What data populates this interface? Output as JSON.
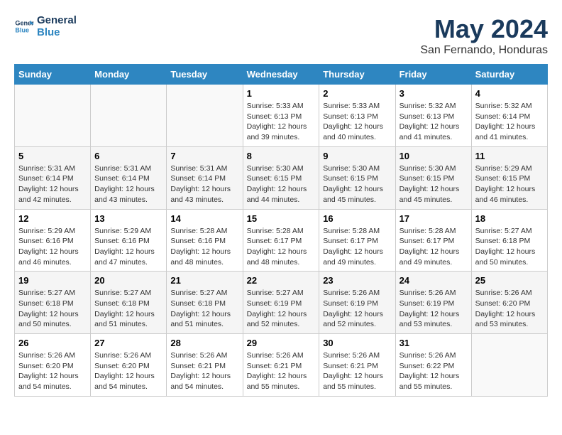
{
  "logo": {
    "line1": "General",
    "line2": "Blue"
  },
  "title": "May 2024",
  "subtitle": "San Fernando, Honduras",
  "weekdays": [
    "Sunday",
    "Monday",
    "Tuesday",
    "Wednesday",
    "Thursday",
    "Friday",
    "Saturday"
  ],
  "weeks": [
    [
      {
        "day": "",
        "info": ""
      },
      {
        "day": "",
        "info": ""
      },
      {
        "day": "",
        "info": ""
      },
      {
        "day": "1",
        "info": "Sunrise: 5:33 AM\nSunset: 6:13 PM\nDaylight: 12 hours\nand 39 minutes."
      },
      {
        "day": "2",
        "info": "Sunrise: 5:33 AM\nSunset: 6:13 PM\nDaylight: 12 hours\nand 40 minutes."
      },
      {
        "day": "3",
        "info": "Sunrise: 5:32 AM\nSunset: 6:13 PM\nDaylight: 12 hours\nand 41 minutes."
      },
      {
        "day": "4",
        "info": "Sunrise: 5:32 AM\nSunset: 6:14 PM\nDaylight: 12 hours\nand 41 minutes."
      }
    ],
    [
      {
        "day": "5",
        "info": "Sunrise: 5:31 AM\nSunset: 6:14 PM\nDaylight: 12 hours\nand 42 minutes."
      },
      {
        "day": "6",
        "info": "Sunrise: 5:31 AM\nSunset: 6:14 PM\nDaylight: 12 hours\nand 43 minutes."
      },
      {
        "day": "7",
        "info": "Sunrise: 5:31 AM\nSunset: 6:14 PM\nDaylight: 12 hours\nand 43 minutes."
      },
      {
        "day": "8",
        "info": "Sunrise: 5:30 AM\nSunset: 6:15 PM\nDaylight: 12 hours\nand 44 minutes."
      },
      {
        "day": "9",
        "info": "Sunrise: 5:30 AM\nSunset: 6:15 PM\nDaylight: 12 hours\nand 45 minutes."
      },
      {
        "day": "10",
        "info": "Sunrise: 5:30 AM\nSunset: 6:15 PM\nDaylight: 12 hours\nand 45 minutes."
      },
      {
        "day": "11",
        "info": "Sunrise: 5:29 AM\nSunset: 6:15 PM\nDaylight: 12 hours\nand 46 minutes."
      }
    ],
    [
      {
        "day": "12",
        "info": "Sunrise: 5:29 AM\nSunset: 6:16 PM\nDaylight: 12 hours\nand 46 minutes."
      },
      {
        "day": "13",
        "info": "Sunrise: 5:29 AM\nSunset: 6:16 PM\nDaylight: 12 hours\nand 47 minutes."
      },
      {
        "day": "14",
        "info": "Sunrise: 5:28 AM\nSunset: 6:16 PM\nDaylight: 12 hours\nand 48 minutes."
      },
      {
        "day": "15",
        "info": "Sunrise: 5:28 AM\nSunset: 6:17 PM\nDaylight: 12 hours\nand 48 minutes."
      },
      {
        "day": "16",
        "info": "Sunrise: 5:28 AM\nSunset: 6:17 PM\nDaylight: 12 hours\nand 49 minutes."
      },
      {
        "day": "17",
        "info": "Sunrise: 5:28 AM\nSunset: 6:17 PM\nDaylight: 12 hours\nand 49 minutes."
      },
      {
        "day": "18",
        "info": "Sunrise: 5:27 AM\nSunset: 6:18 PM\nDaylight: 12 hours\nand 50 minutes."
      }
    ],
    [
      {
        "day": "19",
        "info": "Sunrise: 5:27 AM\nSunset: 6:18 PM\nDaylight: 12 hours\nand 50 minutes."
      },
      {
        "day": "20",
        "info": "Sunrise: 5:27 AM\nSunset: 6:18 PM\nDaylight: 12 hours\nand 51 minutes."
      },
      {
        "day": "21",
        "info": "Sunrise: 5:27 AM\nSunset: 6:18 PM\nDaylight: 12 hours\nand 51 minutes."
      },
      {
        "day": "22",
        "info": "Sunrise: 5:27 AM\nSunset: 6:19 PM\nDaylight: 12 hours\nand 52 minutes."
      },
      {
        "day": "23",
        "info": "Sunrise: 5:26 AM\nSunset: 6:19 PM\nDaylight: 12 hours\nand 52 minutes."
      },
      {
        "day": "24",
        "info": "Sunrise: 5:26 AM\nSunset: 6:19 PM\nDaylight: 12 hours\nand 53 minutes."
      },
      {
        "day": "25",
        "info": "Sunrise: 5:26 AM\nSunset: 6:20 PM\nDaylight: 12 hours\nand 53 minutes."
      }
    ],
    [
      {
        "day": "26",
        "info": "Sunrise: 5:26 AM\nSunset: 6:20 PM\nDaylight: 12 hours\nand 54 minutes."
      },
      {
        "day": "27",
        "info": "Sunrise: 5:26 AM\nSunset: 6:20 PM\nDaylight: 12 hours\nand 54 minutes."
      },
      {
        "day": "28",
        "info": "Sunrise: 5:26 AM\nSunset: 6:21 PM\nDaylight: 12 hours\nand 54 minutes."
      },
      {
        "day": "29",
        "info": "Sunrise: 5:26 AM\nSunset: 6:21 PM\nDaylight: 12 hours\nand 55 minutes."
      },
      {
        "day": "30",
        "info": "Sunrise: 5:26 AM\nSunset: 6:21 PM\nDaylight: 12 hours\nand 55 minutes."
      },
      {
        "day": "31",
        "info": "Sunrise: 5:26 AM\nSunset: 6:22 PM\nDaylight: 12 hours\nand 55 minutes."
      },
      {
        "day": "",
        "info": ""
      }
    ]
  ]
}
